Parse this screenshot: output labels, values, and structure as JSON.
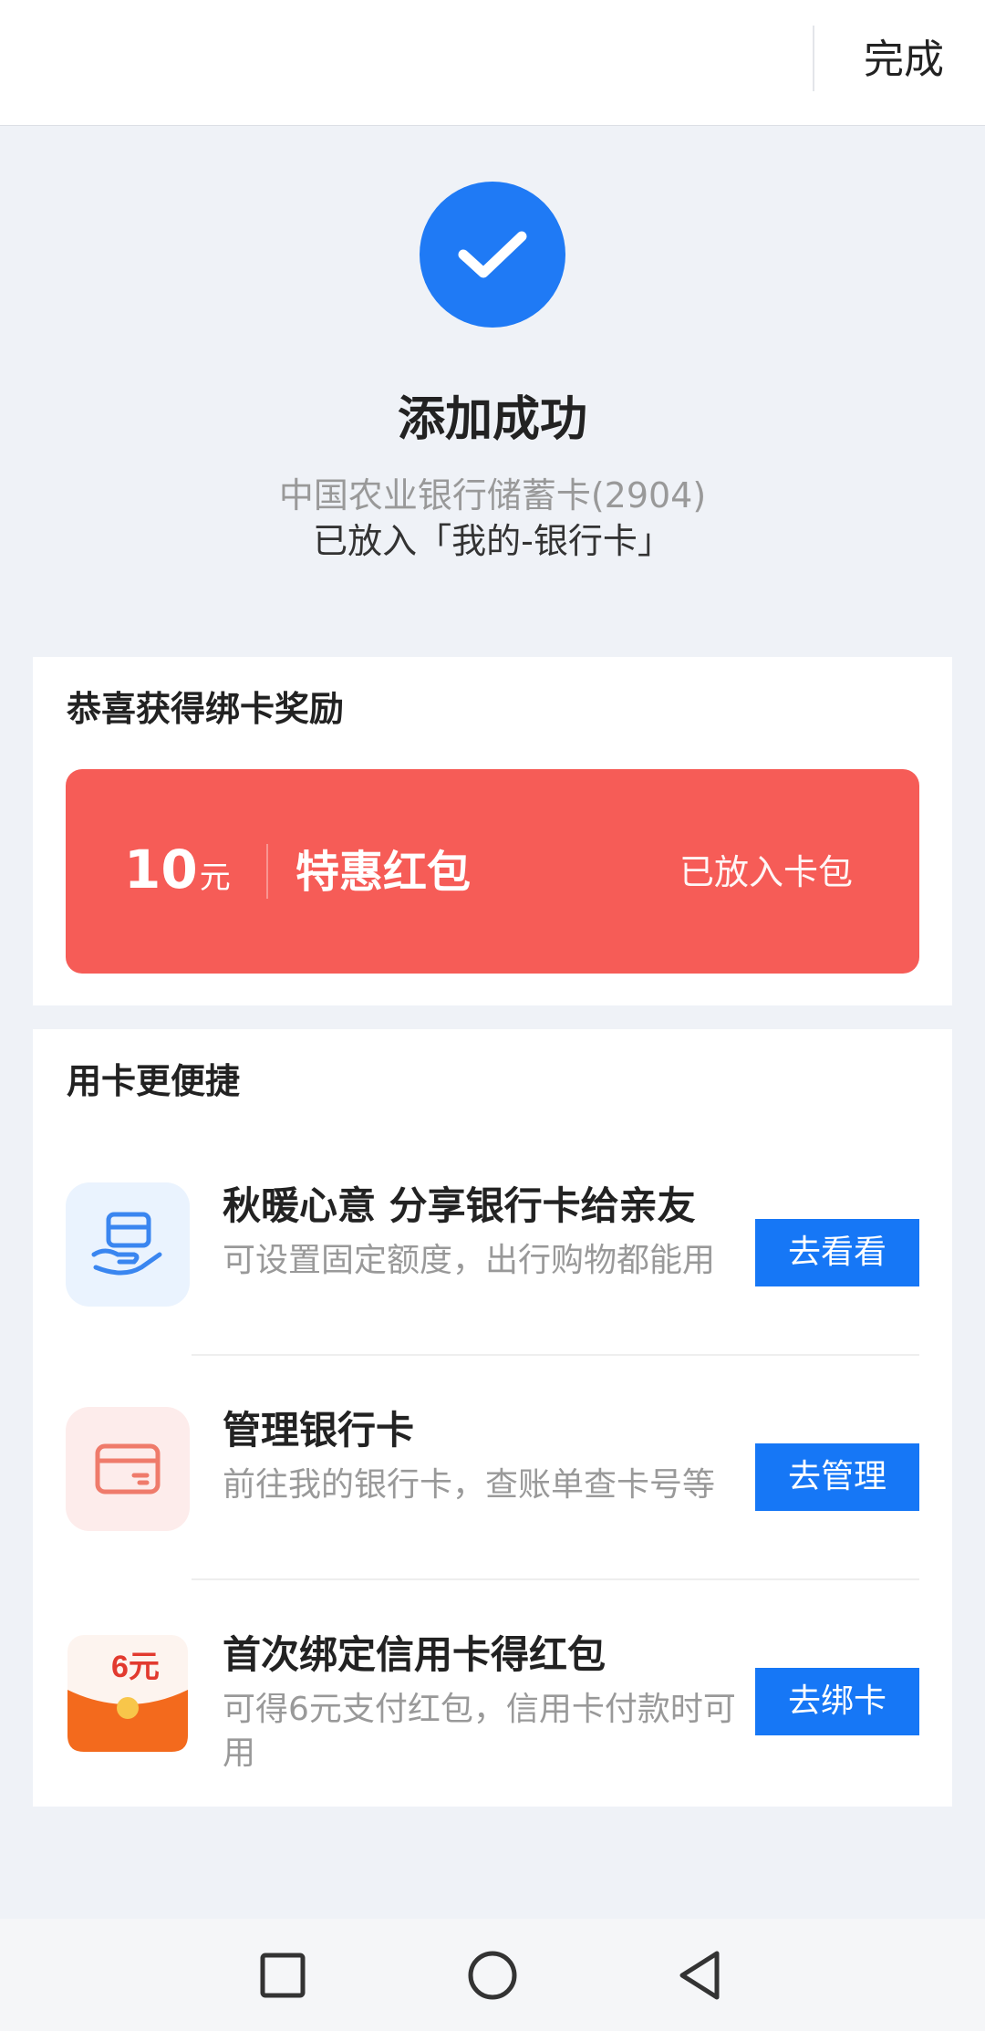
{
  "header": {
    "done_label": "完成"
  },
  "result": {
    "title": "添加成功",
    "subtitle_gray": "中国农业银行储蓄卡(2904)",
    "subtitle_dark": "已放入「我的-银行卡」"
  },
  "reward": {
    "section_title": "恭喜获得绑卡奖励",
    "amount": "10",
    "unit": "元",
    "name": "特惠红包",
    "status": "已放入卡包"
  },
  "features": {
    "section_title": "用卡更便捷",
    "items": [
      {
        "title": "秋暖心意 分享银行卡给亲友",
        "desc": "可设置固定额度，出行购物都能用",
        "button": "去看看",
        "icon": "share-card-icon"
      },
      {
        "title": "管理银行卡",
        "desc": "前往我的银行卡，查账单查卡号等",
        "button": "去管理",
        "icon": "bank-card-icon"
      },
      {
        "title": "首次绑定信用卡得红包",
        "desc": "可得6元支付红包，信用卡付款时可用",
        "button": "去绑卡",
        "icon": "red-envelope-icon",
        "icon_text": "6元"
      }
    ]
  },
  "colors": {
    "accent": "#1677f6",
    "coupon": "#f65c57",
    "background": "#eff2f7"
  }
}
